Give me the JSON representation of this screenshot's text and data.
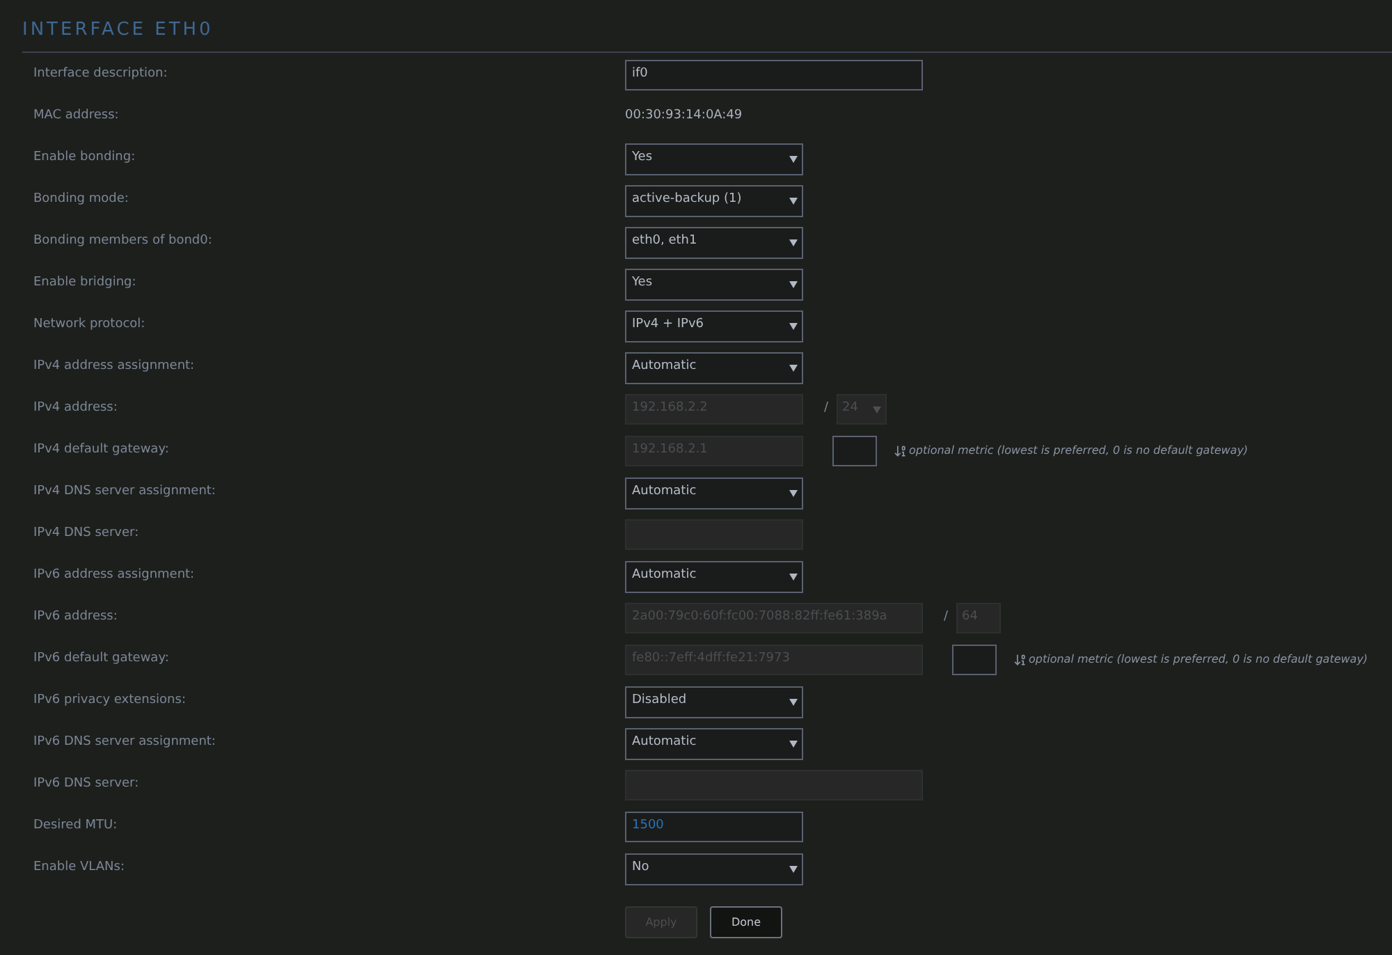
{
  "title": "INTERFACE ETH0",
  "rows": [
    {
      "label": "Interface description:",
      "kind": "text_long",
      "value": "if0"
    },
    {
      "label": "MAC address:",
      "kind": "static",
      "value": "00:30:93:14:0A:49"
    },
    {
      "label": "Enable bonding:",
      "kind": "select",
      "value": "Yes"
    },
    {
      "label": "Bonding mode:",
      "kind": "select",
      "value": "active-backup (1)"
    },
    {
      "label": "Bonding members of bond0:",
      "kind": "select",
      "value": "eth0, eth1"
    },
    {
      "label": "Enable bridging:",
      "kind": "select",
      "value": "Yes"
    },
    {
      "label": "Network protocol:",
      "kind": "select",
      "value": "IPv4 + IPv6"
    },
    {
      "label": "IPv4 address assignment:",
      "kind": "select",
      "value": "Automatic"
    },
    {
      "label": "IPv4 address:",
      "kind": "disabled",
      "value": "192.168.2.2",
      "suffix": {
        "separator": "/",
        "value": "24",
        "kind": "select"
      }
    },
    {
      "label": "IPv4 default gateway:",
      "kind": "disabled",
      "value": "192.168.2.1",
      "metric": {
        "hint": "optional metric (lowest is preferred, 0 is no default gateway)"
      }
    },
    {
      "label": "IPv4 DNS server assignment:",
      "kind": "select",
      "value": "Automatic"
    },
    {
      "label": "IPv4 DNS server:",
      "kind": "disabled"
    },
    {
      "label": "IPv6 address assignment:",
      "kind": "select",
      "value": "Automatic"
    },
    {
      "label": "IPv6 address:",
      "kind": "disabled_long",
      "value": "2a00:79c0:60f:fc00:7088:82ff:fe61:389a",
      "suffix": {
        "separator": "/",
        "value": "64",
        "kind": "text"
      }
    },
    {
      "label": "IPv6 default gateway:",
      "kind": "disabled_long",
      "value": "fe80::7eff:4dff:fe21:7973",
      "metric": {
        "hint": "optional metric (lowest is preferred, 0 is no default gateway)"
      }
    },
    {
      "label": "IPv6 privacy extensions:",
      "kind": "select",
      "value": "Disabled"
    },
    {
      "label": "IPv6 DNS server assignment:",
      "kind": "select",
      "value": "Automatic"
    },
    {
      "label": "IPv6 DNS server:",
      "kind": "disabled_long"
    },
    {
      "label": "Desired MTU:",
      "kind": "number",
      "value": "1500"
    },
    {
      "label": "Enable VLANs:",
      "kind": "select",
      "value": "No"
    }
  ],
  "buttons": [
    {
      "label": "Apply",
      "disabled": true
    },
    {
      "label": "Done",
      "disabled": false
    }
  ]
}
